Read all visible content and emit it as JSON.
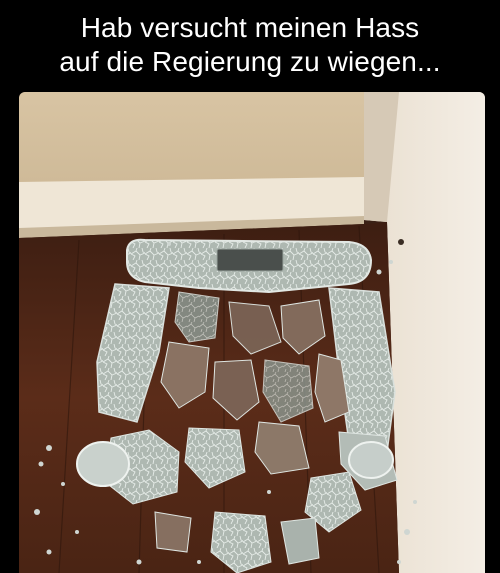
{
  "meme": {
    "caption": "Hab versucht meinen Hass\nauf die Regierung zu wiegen..."
  },
  "photo": {
    "subject": "shattered-glass-bathroom-scale-on-wooden-floor"
  },
  "colors": {
    "background": "#000000",
    "caption_text": "#ffffff",
    "wall": "#d9c7a8",
    "baseboard": "#efe4d2",
    "floor": "#5a2c1a",
    "glass": "#b9c3bd"
  }
}
